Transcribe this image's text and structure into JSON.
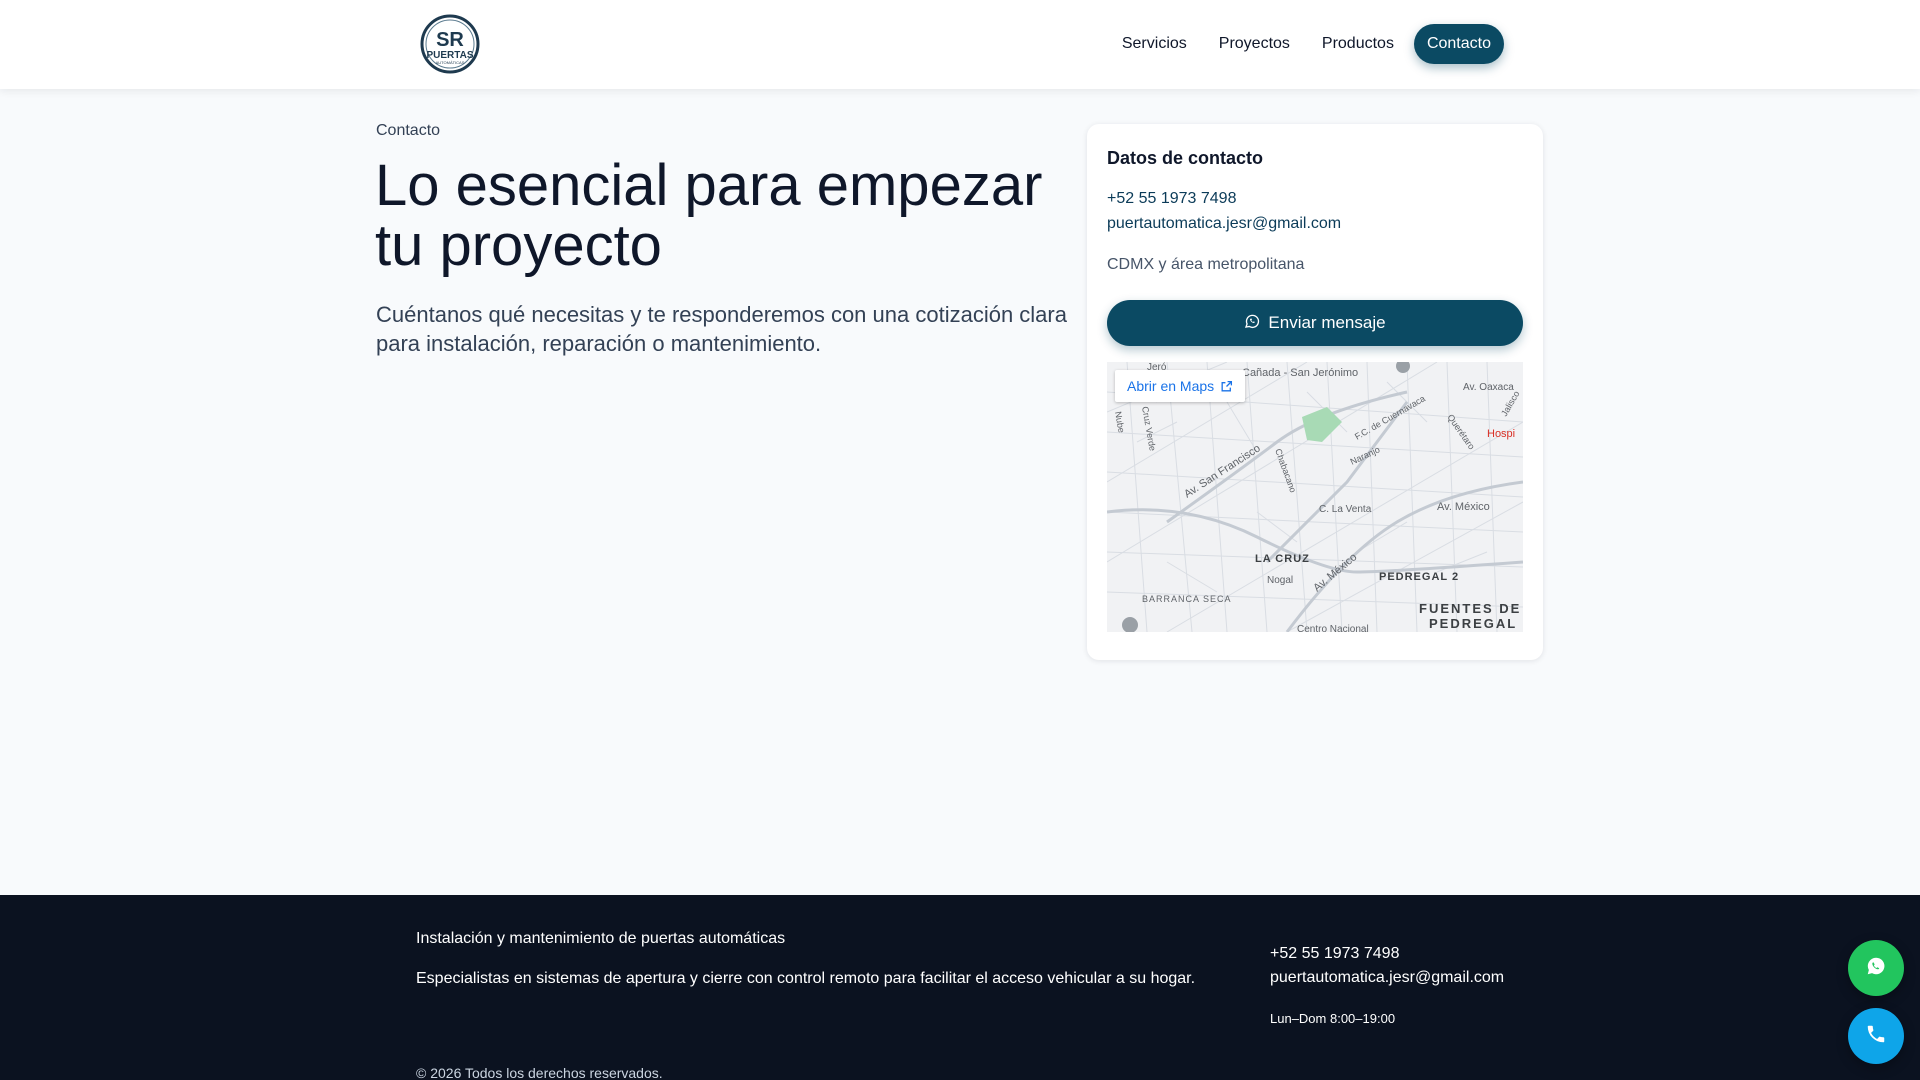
{
  "brand": {
    "logo_line1": "SR",
    "logo_line2": "PUERTAS",
    "logo_line3": "AUTOMÁTICAS"
  },
  "nav": {
    "items": [
      {
        "label": "Servicios"
      },
      {
        "label": "Proyectos"
      },
      {
        "label": "Productos"
      },
      {
        "label": "Contacto"
      }
    ]
  },
  "hero": {
    "eyebrow": "Contacto",
    "title_line1": "Lo esencial para empezar",
    "title_line2": "tu proyecto",
    "subtitle_line1": "Cuéntanos qué necesitas y te responderemos con una cotización clara",
    "subtitle_line2": "para instalación, reparación o mantenimiento."
  },
  "contact_card": {
    "title": "Datos de contacto",
    "phone": "+52 55 1973 7498",
    "email": "puertautomatica.jesr@gmail.com",
    "area": "CDMX y área metropolitana",
    "button_label": "Enviar mensaje",
    "button_icon": "whatsapp-icon"
  },
  "map": {
    "open_label": "Abrir en Maps",
    "labels": [
      "Cañada - San Jerónimo",
      "Av. Oaxaca",
      "Jalisco",
      "Hospi",
      "Nube",
      "Cruz Verde",
      "Av. San Francisco",
      "Chabacano",
      "F.C. de Cuernavaca",
      "Naranjo",
      "Querétaro",
      "C. La Venta",
      "Av. México",
      "LA CRUZ",
      "Nogal",
      "Av. México",
      "PEDREGAL 2",
      "BARRANCA SECA",
      "FUENTES DE",
      "PEDREGAL",
      "Centro Nacional",
      "Jeró"
    ]
  },
  "footer": {
    "tagline": "Instalación y mantenimiento de puertas automáticas",
    "description": "Especialistas en sistemas de apertura y cierre con control remoto para facilitar el acceso vehicular a su hogar.",
    "phone": "+52 55 1973 7498",
    "email": "puertautomatica.jesr@gmail.com",
    "hours": "Lun–Dom 8:00–19:00",
    "copyright": "© 2026 Todos los derechos reservados."
  },
  "floating": {
    "whatsapp_icon": "whatsapp-icon",
    "call_icon": "phone-icon"
  },
  "colors": {
    "primary": "#0b4a63",
    "footer_bg": "#0b1220",
    "whatsapp": "#22c55e",
    "call": "#0ea5e9",
    "page_bg": "#f8fafc"
  }
}
